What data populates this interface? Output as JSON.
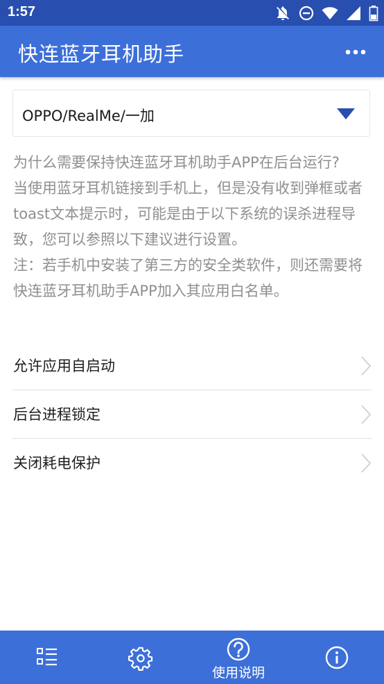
{
  "status_bar": {
    "time": "1:57",
    "icons": [
      "notifications-off-icon",
      "do-not-disturb-icon",
      "wifi-icon",
      "cellular-signal-icon",
      "battery-icon"
    ]
  },
  "app_bar": {
    "title": "快连蓝牙耳机助手",
    "menu_icon": "more-horizontal-icon",
    "color": "#3d6fd9"
  },
  "brand_selector": {
    "selected": "OPPO/RealMe/一加",
    "arrow_icon": "triangle-down-icon",
    "arrow_color": "#284fb0"
  },
  "description": {
    "lines": [
      "为什么需要保持快连蓝牙耳机助手APP在后台运行?",
      "当使用蓝牙耳机链接到手机上，但是没有收到弹框或者toast文本提示时，可能是由于以下系统的误杀进程导致，您可以参照以下建议进行设置。",
      "注：若手机中安装了第三方的安全类软件，则还需要将快连蓝牙耳机助手APP加入其应用白名单。"
    ]
  },
  "settings_list": [
    {
      "label": "允许应用自启动",
      "icon": "chevron-right-icon"
    },
    {
      "label": "后台进程锁定",
      "icon": "chevron-right-icon"
    },
    {
      "label": "关闭耗电保护",
      "icon": "chevron-right-icon"
    }
  ],
  "bottom_nav": {
    "tabs": [
      {
        "icon": "list-icon",
        "label": ""
      },
      {
        "icon": "settings-gear-icon",
        "label": ""
      },
      {
        "icon": "help-circle-icon",
        "label": "使用说明",
        "active": true
      },
      {
        "icon": "info-circle-icon",
        "label": ""
      }
    ]
  }
}
